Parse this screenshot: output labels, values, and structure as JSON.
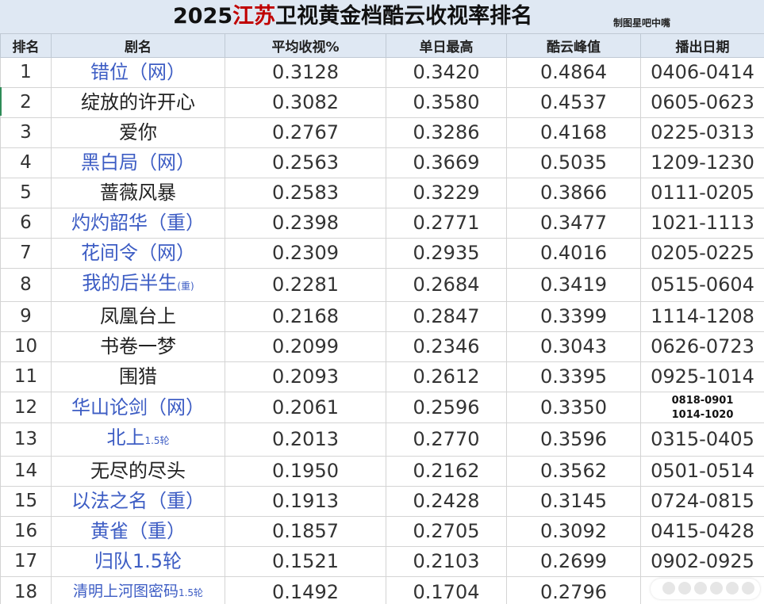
{
  "title": {
    "year": "2025",
    "channel": "江苏",
    "rest": "卫视黄金档酷云收视率排名"
  },
  "credit": "制图星吧中嘴",
  "headers": [
    "排名",
    "剧名",
    "平均收视%",
    "单日最高",
    "酷云峰值",
    "播出日期"
  ],
  "rows": [
    {
      "rank": "1",
      "name": "错位（网）",
      "suffix": "",
      "avg": "0.3128",
      "max": "0.3420",
      "peak": "0.4864",
      "date": "0406-0414",
      "color": "blue"
    },
    {
      "rank": "2",
      "name": "绽放的许开心",
      "suffix": "",
      "avg": "0.3082",
      "max": "0.3580",
      "peak": "0.4537",
      "date": "0605-0623",
      "color": "black"
    },
    {
      "rank": "3",
      "name": "爱你",
      "suffix": "",
      "avg": "0.2767",
      "max": "0.3286",
      "peak": "0.4168",
      "date": "0225-0313",
      "color": "black"
    },
    {
      "rank": "4",
      "name": "黑白局（网）",
      "suffix": "",
      "avg": "0.2563",
      "max": "0.3669",
      "peak": "0.5035",
      "date": "1209-1230",
      "color": "blue"
    },
    {
      "rank": "5",
      "name": "蔷薇风暴",
      "suffix": "",
      "avg": "0.2583",
      "max": "0.3229",
      "peak": "0.3866",
      "date": "0111-0205",
      "color": "black"
    },
    {
      "rank": "6",
      "name": "灼灼韶华（重）",
      "suffix": "",
      "avg": "0.2398",
      "max": "0.2771",
      "peak": "0.3477",
      "date": "1021-1113",
      "color": "blue"
    },
    {
      "rank": "7",
      "name": "花间令（网）",
      "suffix": "",
      "avg": "0.2309",
      "max": "0.2935",
      "peak": "0.4016",
      "date": "0205-0225",
      "color": "blue"
    },
    {
      "rank": "8",
      "name": "我的后半生",
      "suffix": "(重)",
      "avg": "0.2281",
      "max": "0.2684",
      "peak": "0.3419",
      "date": "0515-0604",
      "color": "blue"
    },
    {
      "rank": "9",
      "name": "凤凰台上",
      "suffix": "",
      "avg": "0.2168",
      "max": "0.2847",
      "peak": "0.3399",
      "date": "1114-1208",
      "color": "black"
    },
    {
      "rank": "10",
      "name": "书卷一梦",
      "suffix": "",
      "avg": "0.2099",
      "max": "0.2346",
      "peak": "0.3043",
      "date": "0626-0723",
      "color": "black"
    },
    {
      "rank": "11",
      "name": "围猎",
      "suffix": "",
      "avg": "0.2093",
      "max": "0.2612",
      "peak": "0.3395",
      "date": "0925-1014",
      "color": "black"
    },
    {
      "rank": "12",
      "name": "华山论剑（网）",
      "suffix": "",
      "avg": "0.2061",
      "max": "0.2596",
      "peak": "0.3350",
      "date": "",
      "date_lines": [
        "0818-0901",
        "1014-1020"
      ],
      "color": "blue"
    },
    {
      "rank": "13",
      "name": "北上",
      "suffix": "1.5轮",
      "avg": "0.2013",
      "max": "0.2770",
      "peak": "0.3596",
      "date": "0315-0405",
      "color": "blue"
    },
    {
      "rank": "14",
      "name": "无尽的尽头",
      "suffix": "",
      "avg": "0.1950",
      "max": "0.2162",
      "peak": "0.3562",
      "date": "0501-0514",
      "color": "black"
    },
    {
      "rank": "15",
      "name": "以法之名（重）",
      "suffix": "",
      "avg": "0.1913",
      "max": "0.2428",
      "peak": "0.3145",
      "date": "0724-0815",
      "color": "blue"
    },
    {
      "rank": "16",
      "name": "黄雀（重）",
      "suffix": "",
      "avg": "0.1857",
      "max": "0.2705",
      "peak": "0.3092",
      "date": "0415-0428",
      "color": "blue"
    },
    {
      "rank": "17",
      "name": "归队1.5轮",
      "suffix": "",
      "avg": "0.1521",
      "max": "0.2103",
      "peak": "0.2699",
      "date": "0902-0925",
      "color": "blue"
    },
    {
      "rank": "18",
      "name": "清明上河图密码",
      "suffix": "1.5轮",
      "avg": "0.1492",
      "max": "0.1704",
      "peak": "0.2796",
      "date": "",
      "color": "blue",
      "name_small": true
    }
  ],
  "colors": {
    "title_red": "#c00000",
    "name_blue": "#3d5dc4",
    "header_bg": "#dfe8f3"
  }
}
